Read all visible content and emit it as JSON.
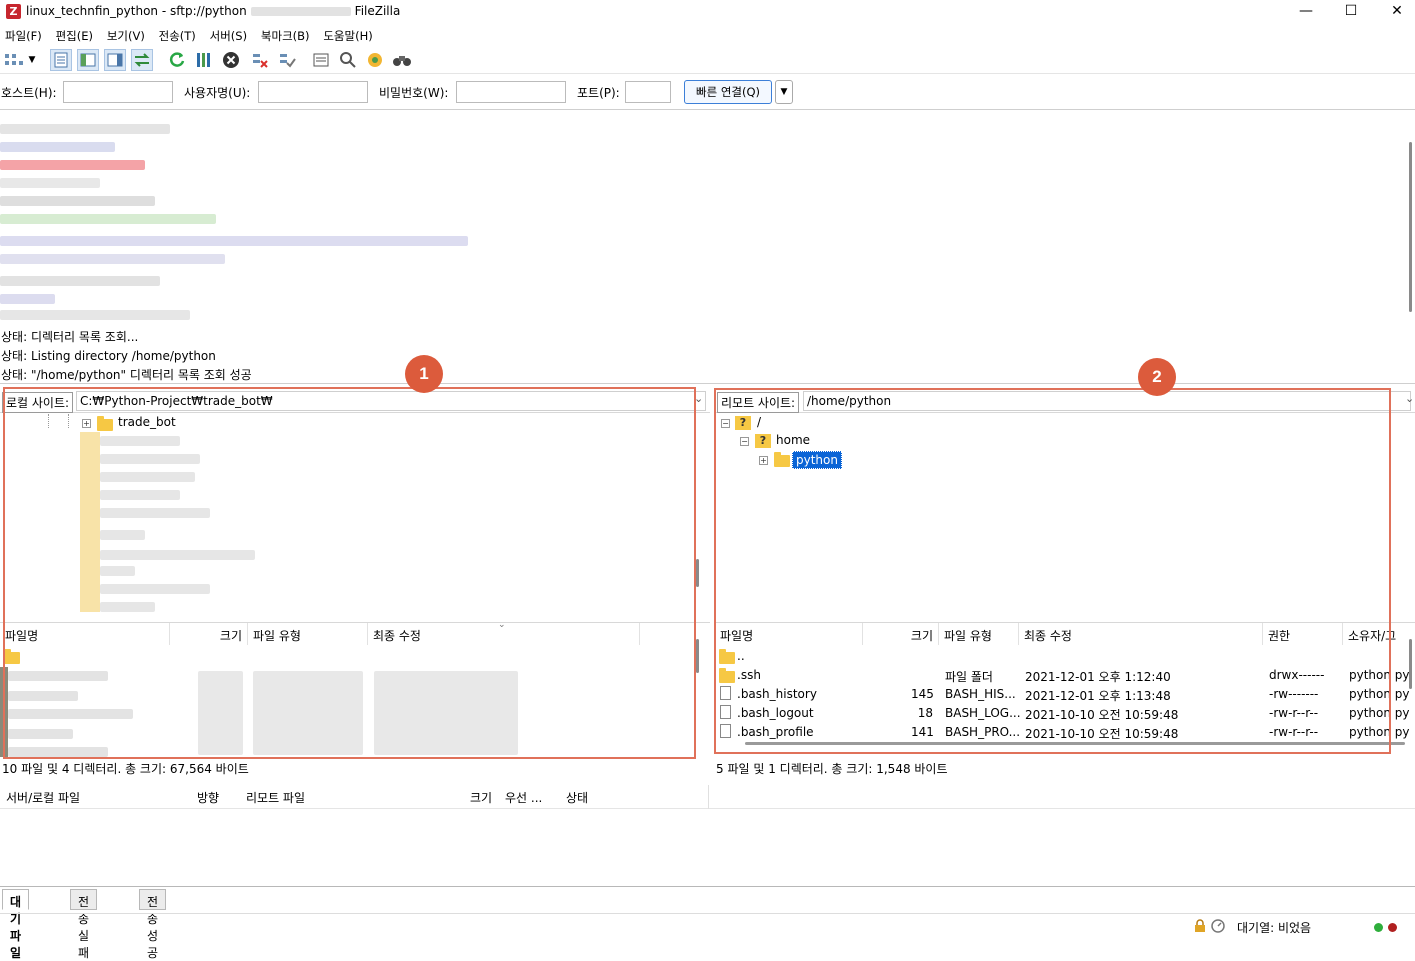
{
  "window": {
    "title": "linux_technfin_python - sftp://python",
    "title_suffix": "FileZilla",
    "controls": [
      "—",
      "☐",
      "✕"
    ]
  },
  "menu": [
    "파일(F)",
    "편집(E)",
    "보기(V)",
    "전송(T)",
    "서버(S)",
    "북마크(B)",
    "도움말(H)"
  ],
  "quickconnect": {
    "host_label": "호스트(H):",
    "user_label": "사용자명(U):",
    "pass_label": "비밀번호(W):",
    "port_label": "포트(P):",
    "connect_label": "빠른 연결(Q)",
    "host_value": "",
    "user_value": "",
    "pass_value": "",
    "port_value": ""
  },
  "log": {
    "lines": [
      "상태: 디렉터리 목록 조회...",
      "상태: Listing directory /home/python",
      "상태: \"/home/python\" 디렉터리 목록 조회 성공"
    ]
  },
  "badges": [
    "1",
    "2"
  ],
  "local": {
    "site_label": "로컬 사이트:",
    "path": "C:₩Python-Project₩trade_bot₩",
    "tree_item": "trade_bot",
    "columns": [
      "파일명",
      "크기",
      "파일 유형",
      "최종 수정"
    ],
    "status": "10 파일 및 4 디렉터리. 총 크기: 67,564 바이트"
  },
  "remote": {
    "site_label": "리모트 사이트:",
    "path": "/home/python",
    "tree": [
      "/",
      "home",
      "python"
    ],
    "columns": [
      "파일명",
      "크기",
      "파일 유형",
      "최종 수정",
      "권한",
      "소유자/그"
    ],
    "rows": [
      {
        "name": "..",
        "size": "",
        "type": "",
        "modified": "",
        "perm": "",
        "owner": ""
      },
      {
        "name": ".ssh",
        "size": "",
        "type": "파일 폴더",
        "modified": "2021-12-01 오후 1:12:40",
        "perm": "drwx------",
        "owner": "python py"
      },
      {
        "name": ".bash_history",
        "size": "145",
        "type": "BASH_HIS...",
        "modified": "2021-12-01 오후 1:13:48",
        "perm": "-rw-------",
        "owner": "python py"
      },
      {
        "name": ".bash_logout",
        "size": "18",
        "type": "BASH_LOG...",
        "modified": "2021-10-10 오전 10:59:48",
        "perm": "-rw-r--r--",
        "owner": "python py"
      },
      {
        "name": ".bash_profile",
        "size": "141",
        "type": "BASH_PRO...",
        "modified": "2021-10-10 오전 10:59:48",
        "perm": "-rw-r--r--",
        "owner": "python py"
      }
    ],
    "status": "5 파일 및 1 디렉터리. 총 크기: 1,548 바이트"
  },
  "queue": {
    "columns": [
      "서버/로컬 파일",
      "방향",
      "리모트 파일",
      "크기",
      "우선 ...",
      "상태"
    ],
    "tabs": [
      "대기 파일",
      "전송 실패",
      "전송 성공"
    ]
  },
  "statusbar": {
    "queue_text": "대기열: 비었음"
  },
  "colors": {
    "highlight": "#0a64d6",
    "annotation": "#dc5b3c",
    "folder": "#f6c844"
  }
}
